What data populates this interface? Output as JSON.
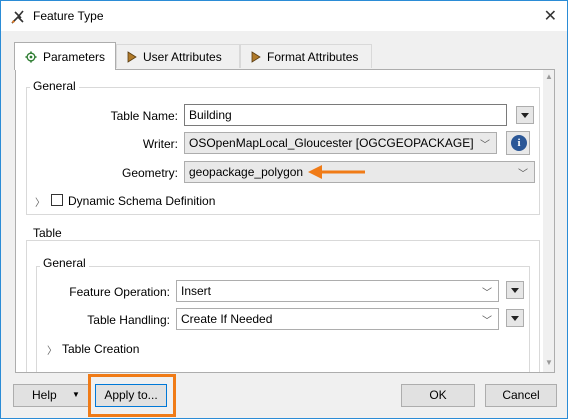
{
  "window": {
    "title": "Feature Type"
  },
  "tabs": [
    {
      "label": "Parameters",
      "icon": "gear-icon"
    },
    {
      "label": "User Attributes",
      "icon": "arrow-right-icon"
    },
    {
      "label": "Format Attributes",
      "icon": "arrow-right-icon"
    }
  ],
  "general": {
    "group_label": "General",
    "table_name_label": "Table Name:",
    "table_name_value": "Building",
    "writer_label": "Writer:",
    "writer_value": "OSOpenMapLocal_Gloucester [OGCGEOPACKAGE]",
    "geometry_label": "Geometry:",
    "geometry_value": "geopackage_polygon",
    "dynamic_schema_label": "Dynamic Schema Definition",
    "dynamic_schema_checked": false
  },
  "table": {
    "group_label": "Table",
    "sub_group_label": "General",
    "feature_operation_label": "Feature Operation:",
    "feature_operation_value": "Insert",
    "table_handling_label": "Table Handling:",
    "table_handling_value": "Create If Needed",
    "table_creation_label": "Table Creation"
  },
  "footer": {
    "help_label": "Help",
    "apply_label": "Apply to...",
    "ok_label": "OK",
    "cancel_label": "Cancel"
  },
  "colors": {
    "accent_orange": "#f07b17",
    "title_border": "#2b8cd6"
  }
}
